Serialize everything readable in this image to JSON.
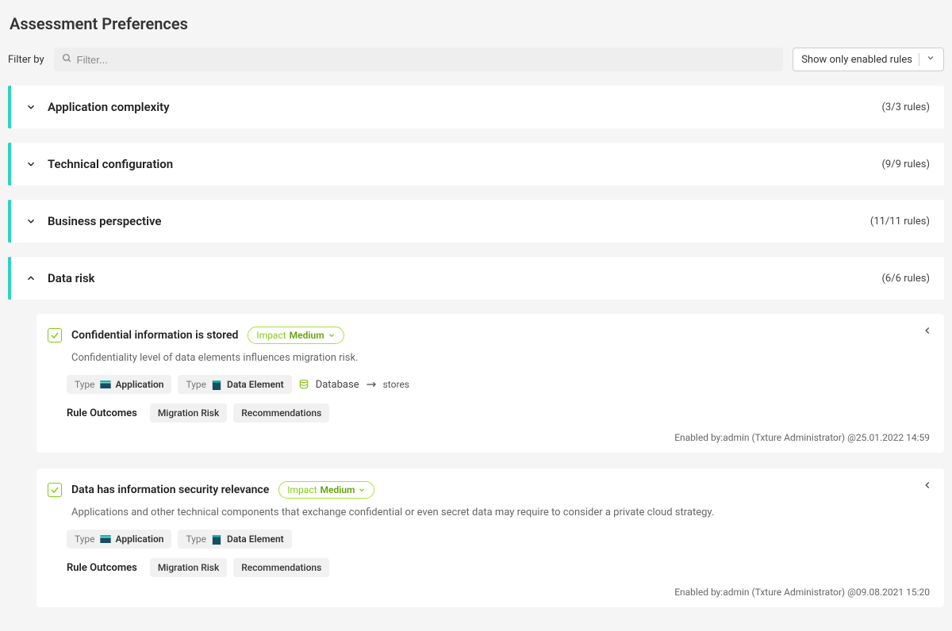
{
  "header": {
    "title": "Assessment Preferences"
  },
  "filter": {
    "label": "Filter by",
    "placeholder": "Filter...",
    "show_only_label": "Show only enabled rules"
  },
  "categories": [
    {
      "title": "Application complexity",
      "count": "(3/3 rules)",
      "expanded": false
    },
    {
      "title": "Technical configuration",
      "count": "(9/9 rules)",
      "expanded": false
    },
    {
      "title": "Business perspective",
      "count": "(11/11 rules)",
      "expanded": false
    },
    {
      "title": "Data risk",
      "count": "(6/6 rules)",
      "expanded": true
    }
  ],
  "rules": [
    {
      "title": "Confidential information is stored",
      "impact_label": "Impact",
      "impact_level": "Medium",
      "description": "Confidentiality level of data elements influences migration risk.",
      "type_label": "Type",
      "types": [
        "Application",
        "Data Element"
      ],
      "db_label": "Database",
      "stores_label": "stores",
      "outcomes_label": "Rule Outcomes",
      "outcomes": [
        "Migration Risk",
        "Recommendations"
      ],
      "footer": "Enabled by:admin (Txture Administrator) @25.01.2022 14:59"
    },
    {
      "title": "Data has information security relevance",
      "impact_label": "Impact",
      "impact_level": "Medium",
      "description": "Applications and other technical components that exchange confidential or even secret data may require to consider a private cloud strategy.",
      "type_label": "Type",
      "types": [
        "Application",
        "Data Element"
      ],
      "outcomes_label": "Rule Outcomes",
      "outcomes": [
        "Migration Risk",
        "Recommendations"
      ],
      "footer": "Enabled by:admin (Txture Administrator) @09.08.2021 15:20"
    }
  ]
}
